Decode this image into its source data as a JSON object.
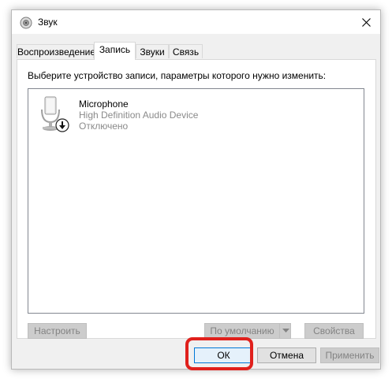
{
  "window": {
    "title": "Звук",
    "close_glyph": "✕"
  },
  "tabs": [
    {
      "label": "Воспроизведение",
      "active": false
    },
    {
      "label": "Запись",
      "active": true
    },
    {
      "label": "Звуки",
      "active": false
    },
    {
      "label": "Связь",
      "active": false
    }
  ],
  "recording": {
    "instruction": "Выберите устройство записи, параметры которого нужно изменить:",
    "devices": [
      {
        "name": "Microphone",
        "description": "High Definition Audio Device",
        "status": "Отключено",
        "icon": "microphone-icon",
        "badge_icon": "disabled-down-arrow-icon"
      }
    ],
    "buttons": {
      "configure": "Настроить",
      "set_default": "По умолчанию",
      "properties": "Свойства"
    }
  },
  "dialog_buttons": {
    "ok": "ОК",
    "cancel": "Отмена",
    "apply": "Применить"
  },
  "colors": {
    "highlight": "#e0201c",
    "focus_border": "#0078d7"
  }
}
